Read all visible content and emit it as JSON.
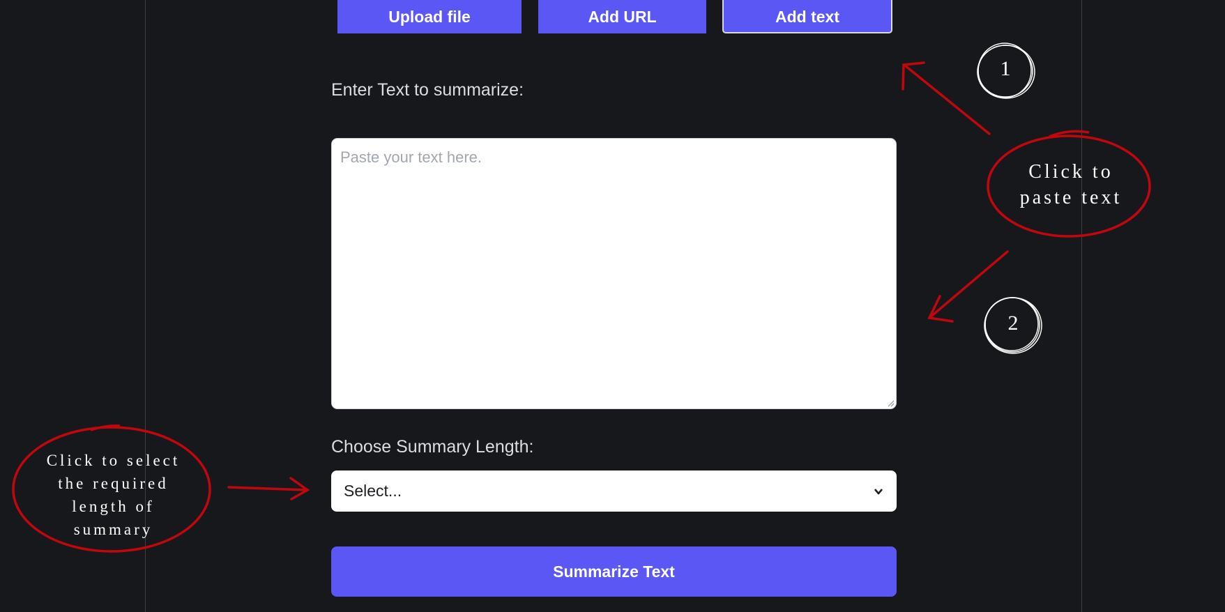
{
  "tabs": [
    {
      "label": "Upload file",
      "active": false
    },
    {
      "label": "Add URL",
      "active": false
    },
    {
      "label": "Add text",
      "active": true
    }
  ],
  "text_input": {
    "label": "Enter Text to summarize:",
    "placeholder": "Paste your text here.",
    "value": ""
  },
  "summary_length": {
    "label": "Choose Summary Length:",
    "selected": "Select..."
  },
  "submit": {
    "label": "Summarize Text"
  },
  "annotations": {
    "right_note_lines": [
      "Click to",
      "paste text"
    ],
    "left_note_lines": [
      "Click to select",
      "the required",
      "length of",
      "summary"
    ],
    "step_1": "1",
    "step_2": "2",
    "ink_color": "#c0070f"
  },
  "colors": {
    "background": "#17181b",
    "accent": "#5b57f5",
    "label_text": "#dcdde2"
  }
}
